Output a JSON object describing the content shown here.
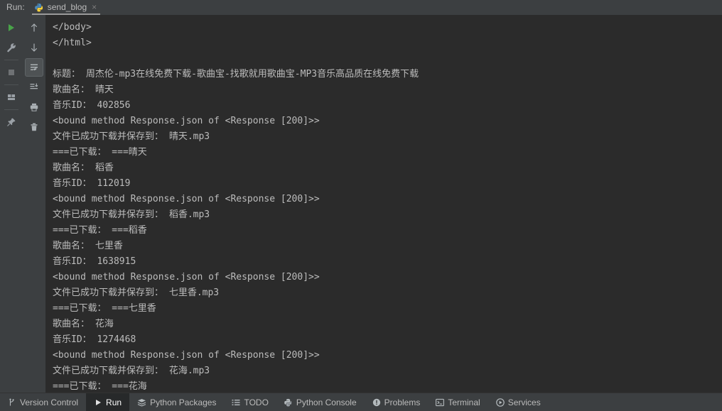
{
  "window": {
    "run_label": "Run:",
    "tab": {
      "title": "send_blog",
      "icon": "python-icon",
      "close": "×"
    }
  },
  "toolbars": {
    "left": [
      {
        "name": "rerun-button",
        "label": "Rerun",
        "icon": "play-icon"
      },
      {
        "name": "debug-settings-button",
        "label": "Modify Run Configuration",
        "icon": "wrench-icon"
      },
      {
        "name": "stop-button",
        "label": "Stop",
        "icon": "stop-icon"
      },
      {
        "name": "layout-button",
        "label": "Layout Settings",
        "icon": "layout-icon"
      },
      {
        "name": "pin-tab-button",
        "label": "Pin Tab",
        "icon": "pin-icon"
      }
    ],
    "right": [
      {
        "name": "up-the-stack-button",
        "label": "Up the Stack Trace",
        "icon": "arrow-up-icon"
      },
      {
        "name": "down-the-stack-button",
        "label": "Down the Stack Trace",
        "icon": "arrow-down-icon"
      },
      {
        "name": "soft-wrap-button",
        "label": "Soft-Wrap",
        "icon": "soft-wrap-icon",
        "active": true
      },
      {
        "name": "scroll-to-end-button",
        "label": "Scroll to End",
        "icon": "scroll-to-end-icon"
      },
      {
        "name": "print-button",
        "label": "Print",
        "icon": "printer-icon"
      },
      {
        "name": "clear-all-button",
        "label": "Clear All",
        "icon": "trash-icon"
      }
    ]
  },
  "console": {
    "lines": [
      "</body>",
      "</html>",
      "",
      "标题： 周杰伦-mp3在线免费下载-歌曲宝-找歌就用歌曲宝-MP3音乐高品质在线免费下载",
      "歌曲名： 晴天",
      "音乐ID： 402856",
      "<bound method Response.json of <Response [200]>>",
      "文件已成功下载并保存到： 晴天.mp3",
      "===已下载： ===晴天",
      "歌曲名： 稻香",
      "音乐ID： 112019",
      "<bound method Response.json of <Response [200]>>",
      "文件已成功下载并保存到： 稻香.mp3",
      "===已下载： ===稻香",
      "歌曲名： 七里香",
      "音乐ID： 1638915",
      "<bound method Response.json of <Response [200]>>",
      "文件已成功下载并保存到： 七里香.mp3",
      "===已下载： ===七里香",
      "歌曲名： 花海",
      "音乐ID： 1274468",
      "<bound method Response.json of <Response [200]>>",
      "文件已成功下载并保存到： 花海.mp3",
      "===已下载： ===花海"
    ]
  },
  "statusbar": {
    "items": [
      {
        "name": "status-version-control",
        "label": "Version Control",
        "icon": "branch-icon",
        "active": false
      },
      {
        "name": "status-run",
        "label": "Run",
        "icon": "play-small-icon",
        "active": true
      },
      {
        "name": "status-python-packages",
        "label": "Python Packages",
        "icon": "packages-icon",
        "active": false
      },
      {
        "name": "status-todo",
        "label": "TODO",
        "icon": "list-icon",
        "active": false
      },
      {
        "name": "status-python-console",
        "label": "Python Console",
        "icon": "python-small-icon",
        "active": false
      },
      {
        "name": "status-problems",
        "label": "Problems",
        "icon": "warning-icon",
        "active": false
      },
      {
        "name": "status-terminal",
        "label": "Terminal",
        "icon": "terminal-icon",
        "active": false
      },
      {
        "name": "status-services",
        "label": "Services",
        "icon": "services-icon",
        "active": false
      }
    ]
  },
  "colors": {
    "chrome": "#3c3f41",
    "console_bg": "#2b2b2b",
    "console_text": "#bcbcbc",
    "accent_green": "#4caf50",
    "active_status_bg": "#27292a"
  }
}
